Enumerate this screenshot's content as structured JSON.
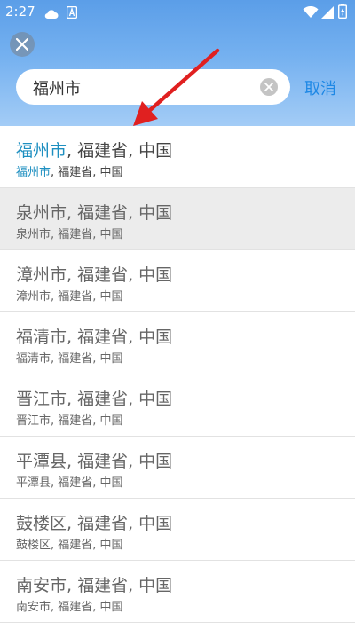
{
  "status_bar": {
    "time": "2:27",
    "icons": [
      "cloud-icon",
      "notification-a-icon",
      "wifi-icon",
      "signal-icon",
      "battery-icon"
    ]
  },
  "colors": {
    "header_gradient_top": "#5b9ee8",
    "header_gradient_bottom": "#a3ccf6",
    "accent": "#1e88e5",
    "match_highlight": "#1e8fc0",
    "annotation_arrow": "#e02020"
  },
  "search": {
    "value": "福州市",
    "cancel_label": "取消"
  },
  "results": [
    {
      "match": "福州市",
      "title": ", 福建省, 中国",
      "sub_match": "福州市",
      "subtitle": ", 福建省, 中国"
    },
    {
      "title": "泉州市, 福建省, 中国",
      "subtitle": "泉州市, 福建省, 中国"
    },
    {
      "title": "漳州市, 福建省, 中国",
      "subtitle": "漳州市, 福建省, 中国"
    },
    {
      "title": "福清市, 福建省, 中国",
      "subtitle": "福清市, 福建省, 中国"
    },
    {
      "title": "晋江市, 福建省, 中国",
      "subtitle": "晋江市, 福建省, 中国"
    },
    {
      "title": "平潭县, 福建省, 中国",
      "subtitle": "平潭县, 福建省, 中国"
    },
    {
      "title": "鼓楼区, 福建省, 中国",
      "subtitle": "鼓楼区, 福建省, 中国"
    },
    {
      "title": "南安市, 福建省, 中国",
      "subtitle": "南安市, 福建省, 中国"
    }
  ]
}
